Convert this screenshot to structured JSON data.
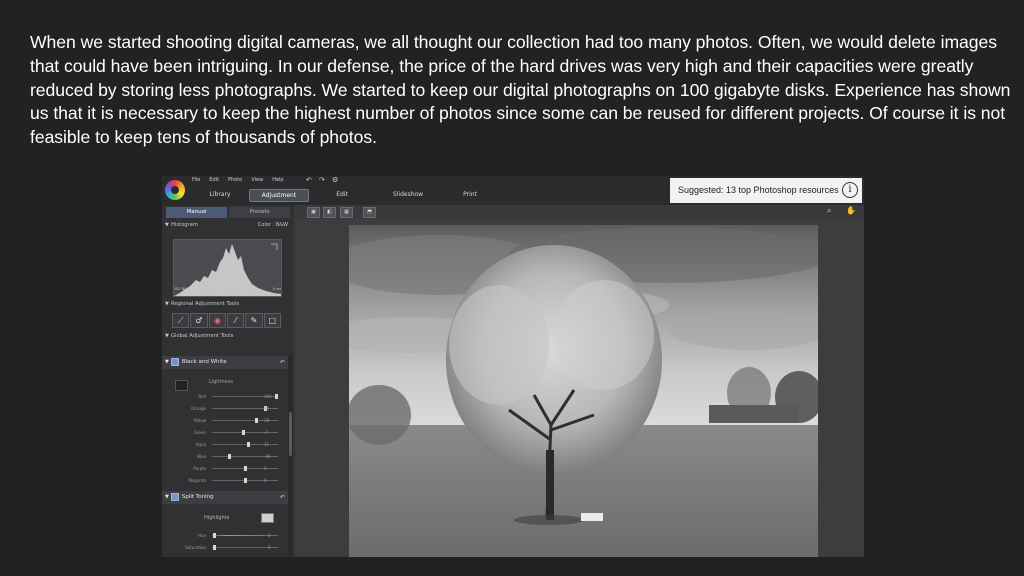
{
  "slide": {
    "paragraph": "When we started shooting digital cameras, we all thought our collection had too many photos. Often, we would delete images that could have been intriguing. In our defense, the price of the hard drives was very high and their capacities were greatly reduced by storing less photographs. We started to keep our digital photographs on 100 gigabyte disks. Experience has shown us that it is necessary to keep the highest number of photos since some can be reused for different projects. Of course it is not feasible to keep tens of thousands of photos."
  },
  "app": {
    "menu": [
      "File",
      "Edit",
      "Photo",
      "View",
      "Help"
    ],
    "modules": [
      "Library",
      "Adjustment",
      "Edit",
      "Slideshow",
      "Print"
    ],
    "active_module": "Adjustment",
    "suggestion": "Suggested: 13 top Photoshop resources",
    "suggestion_icon": "info-icon",
    "panel_tabs": [
      "Manual",
      "Presets"
    ],
    "active_panel_tab": "Manual",
    "histogram": {
      "title": "Histogram",
      "color_label": "Color : B&W",
      "stats": [
        "ISO 80",
        "5 mm",
        "f/4.5",
        "1/40",
        "0 ev"
      ]
    },
    "regional_tools": {
      "title": "Regional Adjustment Tools",
      "icons": [
        "curve-icon",
        "dropper-icon",
        "eye-icon",
        "brush-icon",
        "pen-icon",
        "square-icon"
      ]
    },
    "global_tools": {
      "title": "Global Adjustment Tools"
    },
    "black_white": {
      "title": "Black and White",
      "lightness_label": "Lightness",
      "sliders": [
        {
          "name": "Red",
          "value": "100",
          "pos": 1.0
        },
        {
          "name": "Orange",
          "value": "64",
          "pos": 0.82
        },
        {
          "name": "Yellow",
          "value": "38",
          "pos": 0.69
        },
        {
          "name": "Green",
          "value": "-7",
          "pos": 0.47
        },
        {
          "name": "Aqua",
          "value": "11",
          "pos": 0.56
        },
        {
          "name": "Blue",
          "value": "-49",
          "pos": 0.26
        },
        {
          "name": "Purple",
          "value": "0",
          "pos": 0.5
        },
        {
          "name": "Magenta",
          "value": "0",
          "pos": 0.5
        }
      ]
    },
    "split_toning": {
      "title": "Split Toning",
      "highlights_label": "Highlights",
      "hue_label": "Hue",
      "hue_value": "0",
      "saturation_label": "Saturation",
      "saturation_value": "0"
    },
    "colors": {
      "accent": "#7794c9",
      "panel_bg": "#313134",
      "topbar_bg": "#2b2b2e"
    }
  }
}
